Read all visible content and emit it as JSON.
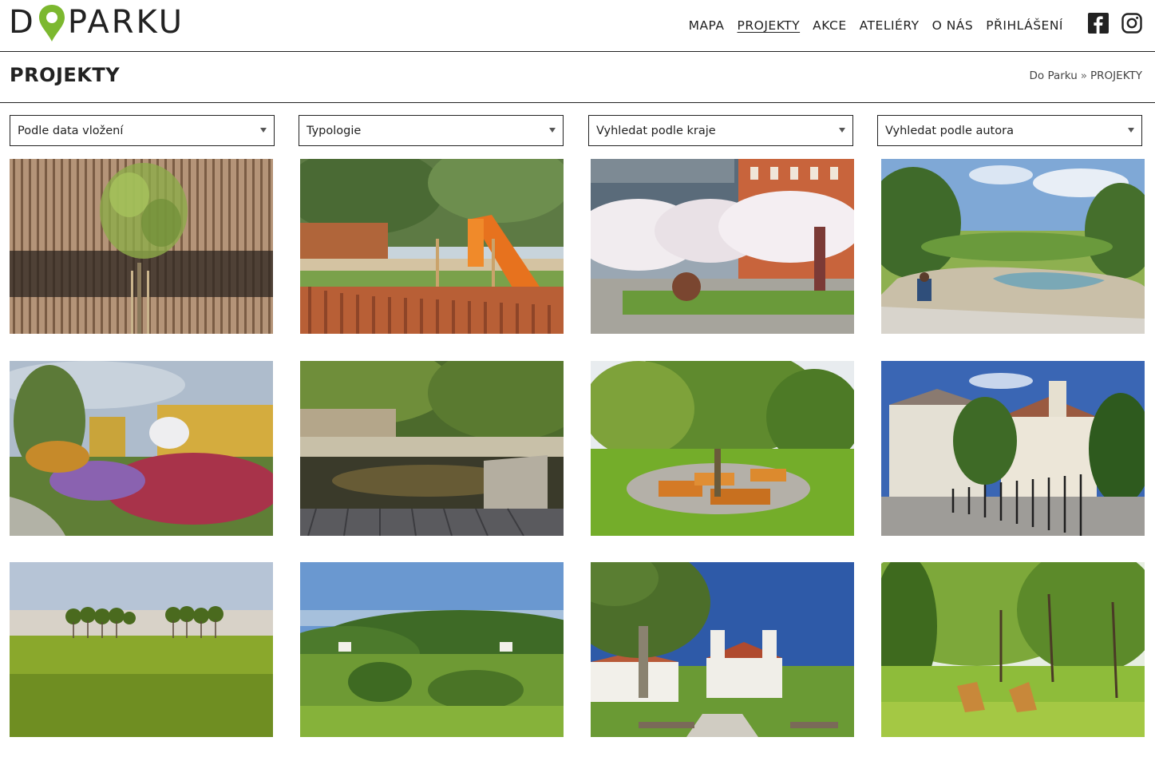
{
  "brand": {
    "logo_left": "D",
    "logo_right": "PARKU"
  },
  "nav": {
    "items": [
      {
        "label": "MAPA",
        "active": false
      },
      {
        "label": "PROJEKTY",
        "active": true
      },
      {
        "label": "AKCE",
        "active": false
      },
      {
        "label": "ATELIÉRY",
        "active": false
      },
      {
        "label": "O NÁS",
        "active": false
      },
      {
        "label": "PŘIHLÁŠENÍ",
        "active": false
      }
    ],
    "social": [
      "facebook-icon",
      "instagram-icon"
    ]
  },
  "page": {
    "title": "PROJEKTY",
    "breadcrumb": {
      "home": "Do Parku",
      "separator": "»",
      "current": "PROJEKTY"
    }
  },
  "filters": {
    "sort": "Podle data vložení",
    "typology": "Typologie",
    "region": "Vyhledat podle kraje",
    "author": "Vyhledat podle autora"
  },
  "projects": [
    {
      "scene": "wooden-slat-facade-with-young-tree"
    },
    {
      "scene": "playground-with-orange-slide"
    },
    {
      "scene": "blossoming-cherry-trees-courtyard"
    },
    {
      "scene": "park-visualization-with-pond"
    },
    {
      "scene": "perennial-garden-with-yellow-walls"
    },
    {
      "scene": "stone-pool-under-trees"
    },
    {
      "scene": "wooden-benches-in-park"
    },
    {
      "scene": "chateau-with-garden-fence"
    },
    {
      "scene": "tree-row-on-meadow"
    },
    {
      "scene": "green-hills-with-houses"
    },
    {
      "scene": "chateau-with-plane-tree"
    },
    {
      "scene": "park-with-wooden-loungers"
    }
  ],
  "colors": {
    "brand_green": "#7cb82f",
    "text": "#222222"
  }
}
